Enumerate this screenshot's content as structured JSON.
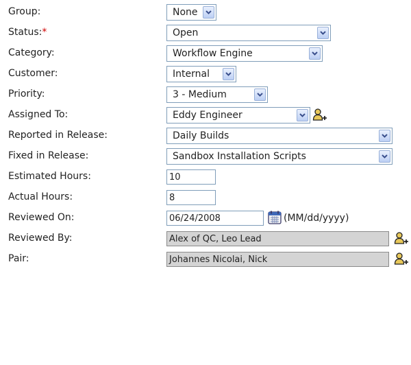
{
  "form": {
    "group": {
      "label": "Group:",
      "value": "None"
    },
    "status": {
      "label": "Status:",
      "required_mark": "*",
      "value": "Open"
    },
    "category": {
      "label": "Category:",
      "value": "Workflow Engine"
    },
    "customer": {
      "label": "Customer:",
      "value": "Internal"
    },
    "priority": {
      "label": "Priority:",
      "value": "3 - Medium"
    },
    "assigned_to": {
      "label": "Assigned To:",
      "value": "Eddy Engineer"
    },
    "reported_in_release": {
      "label": "Reported in Release:",
      "value": "Daily Builds"
    },
    "fixed_in_release": {
      "label": "Fixed in Release:",
      "value": "Sandbox Installation Scripts"
    },
    "estimated_hours": {
      "label": "Estimated Hours:",
      "value": "10"
    },
    "actual_hours": {
      "label": "Actual Hours:",
      "value": "8"
    },
    "reviewed_on": {
      "label": "Reviewed On:",
      "value": "06/24/2008",
      "format_hint": "(MM/dd/yyyy)"
    },
    "reviewed_by": {
      "label": "Reviewed By:",
      "value": "Alex of QC, Leo Lead"
    },
    "pair": {
      "label": "Pair:",
      "value": "Johannes Nicolai, Nick"
    }
  },
  "icons": {
    "dropdown_arrow": "chevron-down-icon",
    "add_user": "add-user-icon",
    "calendar": "calendar-icon"
  },
  "colors": {
    "required": "#d00000",
    "readonly_bg": "#d4d4d4",
    "border": "#7f9db9"
  }
}
